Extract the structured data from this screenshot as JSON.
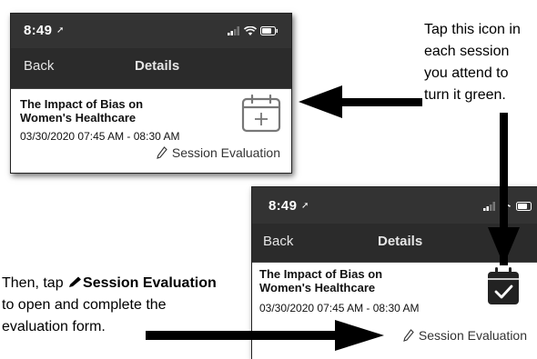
{
  "screen1": {
    "status_time": "8:49",
    "back_label": "Back",
    "nav_title": "Details",
    "session_title_line1": "The Impact of Bias on",
    "session_title_line2": "Women's Healthcare",
    "session_time": "03/30/2020 07:45 AM - 08:30 AM",
    "evaluation_label": "Session Evaluation",
    "calendar_icon": "calendar-add-icon"
  },
  "screen2": {
    "status_time": "8:49",
    "back_label": "Back",
    "nav_title": "Details",
    "session_title_line1": "The Impact of Bias on",
    "session_title_line2": "Women's Healthcare",
    "session_time": "03/30/2020 07:45 AM - 08:30 AM",
    "evaluation_label": "Session Evaluation",
    "calendar_icon": "calendar-check-icon"
  },
  "instructions": {
    "right_line1": "Tap this icon in",
    "right_line2": "each session",
    "right_line3": "you attend to",
    "right_line4": "turn it green.",
    "left_prefix": "Then, tap ",
    "left_bold": "Session Evaluation",
    "left_line2": "to open and complete the",
    "left_line3": "evaluation form."
  },
  "colors": {
    "statusbar": "#333333",
    "navbar": "#2b2b2b",
    "icon_gray": "#777777",
    "icon_dark": "#222222",
    "arrow": "#000000"
  }
}
